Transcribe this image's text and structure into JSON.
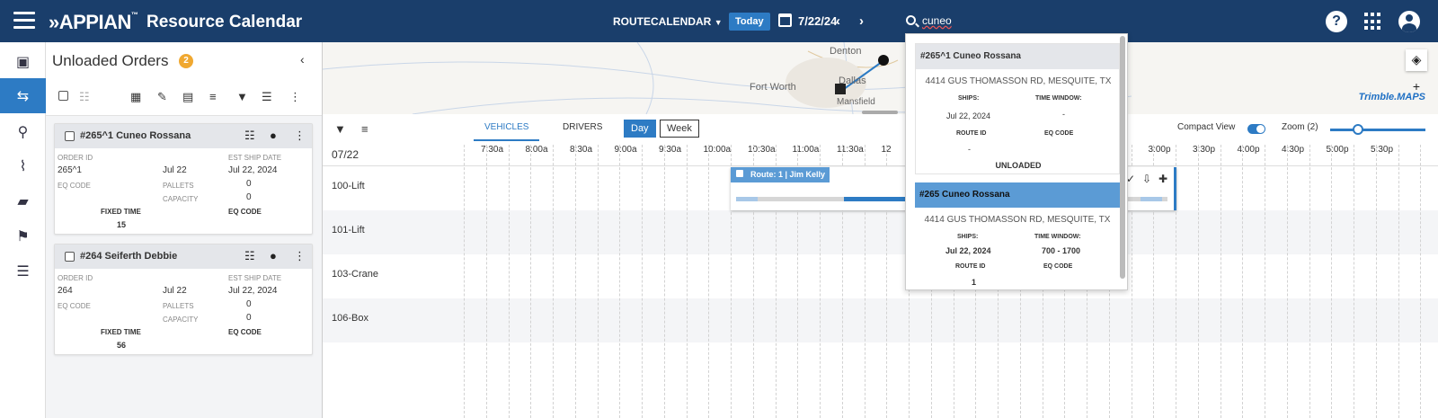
{
  "header": {
    "logo": "APPIAN",
    "title": "Resource Calendar",
    "calendar_select": "ROUTECALENDAR",
    "today_label": "Today",
    "date": "7/22/24",
    "search_value": "cuneo"
  },
  "panel": {
    "title": "Unloaded Orders",
    "count": "2",
    "orders": [
      {
        "title": "#265^1 Cuneo Rossana",
        "order_id_label": "ORDER ID",
        "order_id": "265^1",
        "date_short": "Jul 22",
        "est_ship_label": "EST SHIP DATE",
        "est_ship": "Jul 22, 2024",
        "eq_code_label": "EQ CODE",
        "pallets_label": "PALLETS",
        "pallets": "0",
        "capacity_label": "CAPACITY",
        "capacity": "0",
        "fixed_time_label": "FIXED TIME",
        "fixed_time": "15",
        "eq_code2_label": "EQ CODE"
      },
      {
        "title": "#264 Seiferth Debbie",
        "order_id_label": "ORDER ID",
        "order_id": "264",
        "date_short": "Jul 22",
        "est_ship_label": "EST SHIP DATE",
        "est_ship": "Jul 22, 2024",
        "eq_code_label": "EQ CODE",
        "pallets_label": "PALLETS",
        "pallets": "0",
        "capacity_label": "CAPACITY",
        "capacity": "0",
        "fixed_time_label": "FIXED TIME",
        "fixed_time": "56",
        "eq_code2_label": "EQ CODE"
      }
    ]
  },
  "map": {
    "towns": [
      "Denton",
      "Fort Worth",
      "Dallas",
      "Mansfield"
    ],
    "attribution": "Trimble.MAPS"
  },
  "calendar": {
    "tabs": [
      "VEHICLES",
      "DRIVERS"
    ],
    "view_buttons": [
      "Day",
      "Week"
    ],
    "compact_label": "Compact View",
    "zoom_label": "Zoom (2)",
    "zoom_level_fraction": 0.24,
    "day_label": "07/22",
    "times": [
      "7:30a",
      "8:00a",
      "8:30a",
      "9:00a",
      "9:30a",
      "10:00a",
      "10:30a",
      "11:00a",
      "11:30a",
      "12",
      "3:30p",
      "3:00p",
      "3:30p",
      "4:00p",
      "4:30p",
      "5:00p",
      "5:30p"
    ],
    "vehicles": [
      "100-Lift",
      "101-Lift",
      "103-Crane",
      "106-Box"
    ],
    "route_label": "Route: 1",
    "driver_label": "Jim Kelly"
  },
  "popup": {
    "items": [
      {
        "title": "#265^1 Cuneo Rossana",
        "address": "4414 GUS THOMASSON RD, MESQUITE, TX",
        "ships_label": "SHIPS:",
        "ships": "Jul 22, 2024",
        "window_label": "TIME WINDOW:",
        "window": "-",
        "route_label": "ROUTE ID",
        "route": "-",
        "eq_label": "EQ CODE",
        "status": "UNLOADED"
      },
      {
        "title": "#265 Cuneo Rossana",
        "address": "4414 GUS THOMASSON RD, MESQUITE, TX",
        "ships_label": "SHIPS:",
        "ships": "Jul 22, 2024",
        "window_label": "TIME WINDOW:",
        "window": "700 - 1700",
        "route_label": "ROUTE ID",
        "route": "1",
        "eq_label": "EQ CODE"
      }
    ]
  },
  "colors": {
    "header_bg": "#1a3e6b",
    "accent": "#2d7bc4",
    "badge": "#f0a830"
  }
}
